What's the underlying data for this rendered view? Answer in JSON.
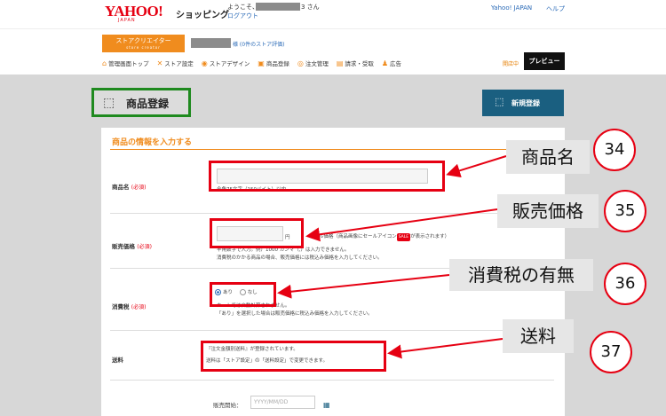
{
  "header": {
    "logo_text": "YAHOO!",
    "logo_sub": "JAPAN",
    "shopping": "ショッピング",
    "welcome_prefix": "ようこそ、",
    "welcome_suffix": "3 さん",
    "logout": "ログアウト",
    "yahoo_japan_link": "Yahoo! JAPAN",
    "help_link": "ヘルプ"
  },
  "store": {
    "creator_label": "ストアクリエイター",
    "creator_sub": "store creator",
    "rating": "様 (0件のストア評価)",
    "status": "開店中",
    "preview_label": "プレビュー"
  },
  "nav": [
    {
      "icon": "home-icon",
      "glyph": "⌂",
      "label": "管理画面トップ"
    },
    {
      "icon": "tools-icon",
      "glyph": "✕",
      "label": "ストア設定"
    },
    {
      "icon": "palette-icon",
      "glyph": "◉",
      "label": "ストアデザイン"
    },
    {
      "icon": "box-icon",
      "glyph": "▣",
      "label": "商品登録"
    },
    {
      "icon": "order-icon",
      "glyph": "◎",
      "label": "注文管理"
    },
    {
      "icon": "invoice-icon",
      "glyph": "▤",
      "label": "請求・受取"
    },
    {
      "icon": "ad-icon",
      "glyph": "♟",
      "label": "広告"
    }
  ],
  "page": {
    "title": "商品登録",
    "new_button": "新規登録",
    "section_title": "商品の情報を入力する"
  },
  "form": {
    "name": {
      "label": "商品名",
      "required": "(必須)",
      "note": "全角75文字（150バイト）以内"
    },
    "price": {
      "label": "販売価格",
      "required": "(必須)",
      "unit": "円",
      "sale_note_pre": "セール価格（商品画像にセールアイコン",
      "sale_badge": "SALE",
      "sale_note_post": "が表示されます）",
      "note1": "半角数字で入力。例）1000 カンマ（,）は入力できません。",
      "note2": "消費税のかかる商品の場合、販売価格には税込み価格を入力してください。"
    },
    "tax": {
      "label": "消費税",
      "required": "(必須)",
      "option_yes": "あり",
      "option_no": "なし",
      "note1": "カートでは自動計算されません。",
      "note2": "「あり」を選択した場合は販売価格に税込み価格を入力してください。"
    },
    "shipping": {
      "label": "送料",
      "note1": "『注文金額別送料』が登録されています。",
      "note2": "送料は「ストア設定」の「送料設定」で変更できます。"
    },
    "sale_start": {
      "label": "販売開始：",
      "placeholder": "YYYY/MM/DD"
    }
  },
  "annotations": [
    {
      "callout": "商品名",
      "number": "34"
    },
    {
      "callout": "販売価格",
      "number": "35"
    },
    {
      "callout": "消費税の有無",
      "number": "36"
    },
    {
      "callout": "送料",
      "number": "37"
    }
  ],
  "colors": {
    "brand_red": "#e60012",
    "accent_orange": "#f08c1e",
    "highlight_green": "#1f8a1f",
    "button_teal": "#1a5f80"
  }
}
